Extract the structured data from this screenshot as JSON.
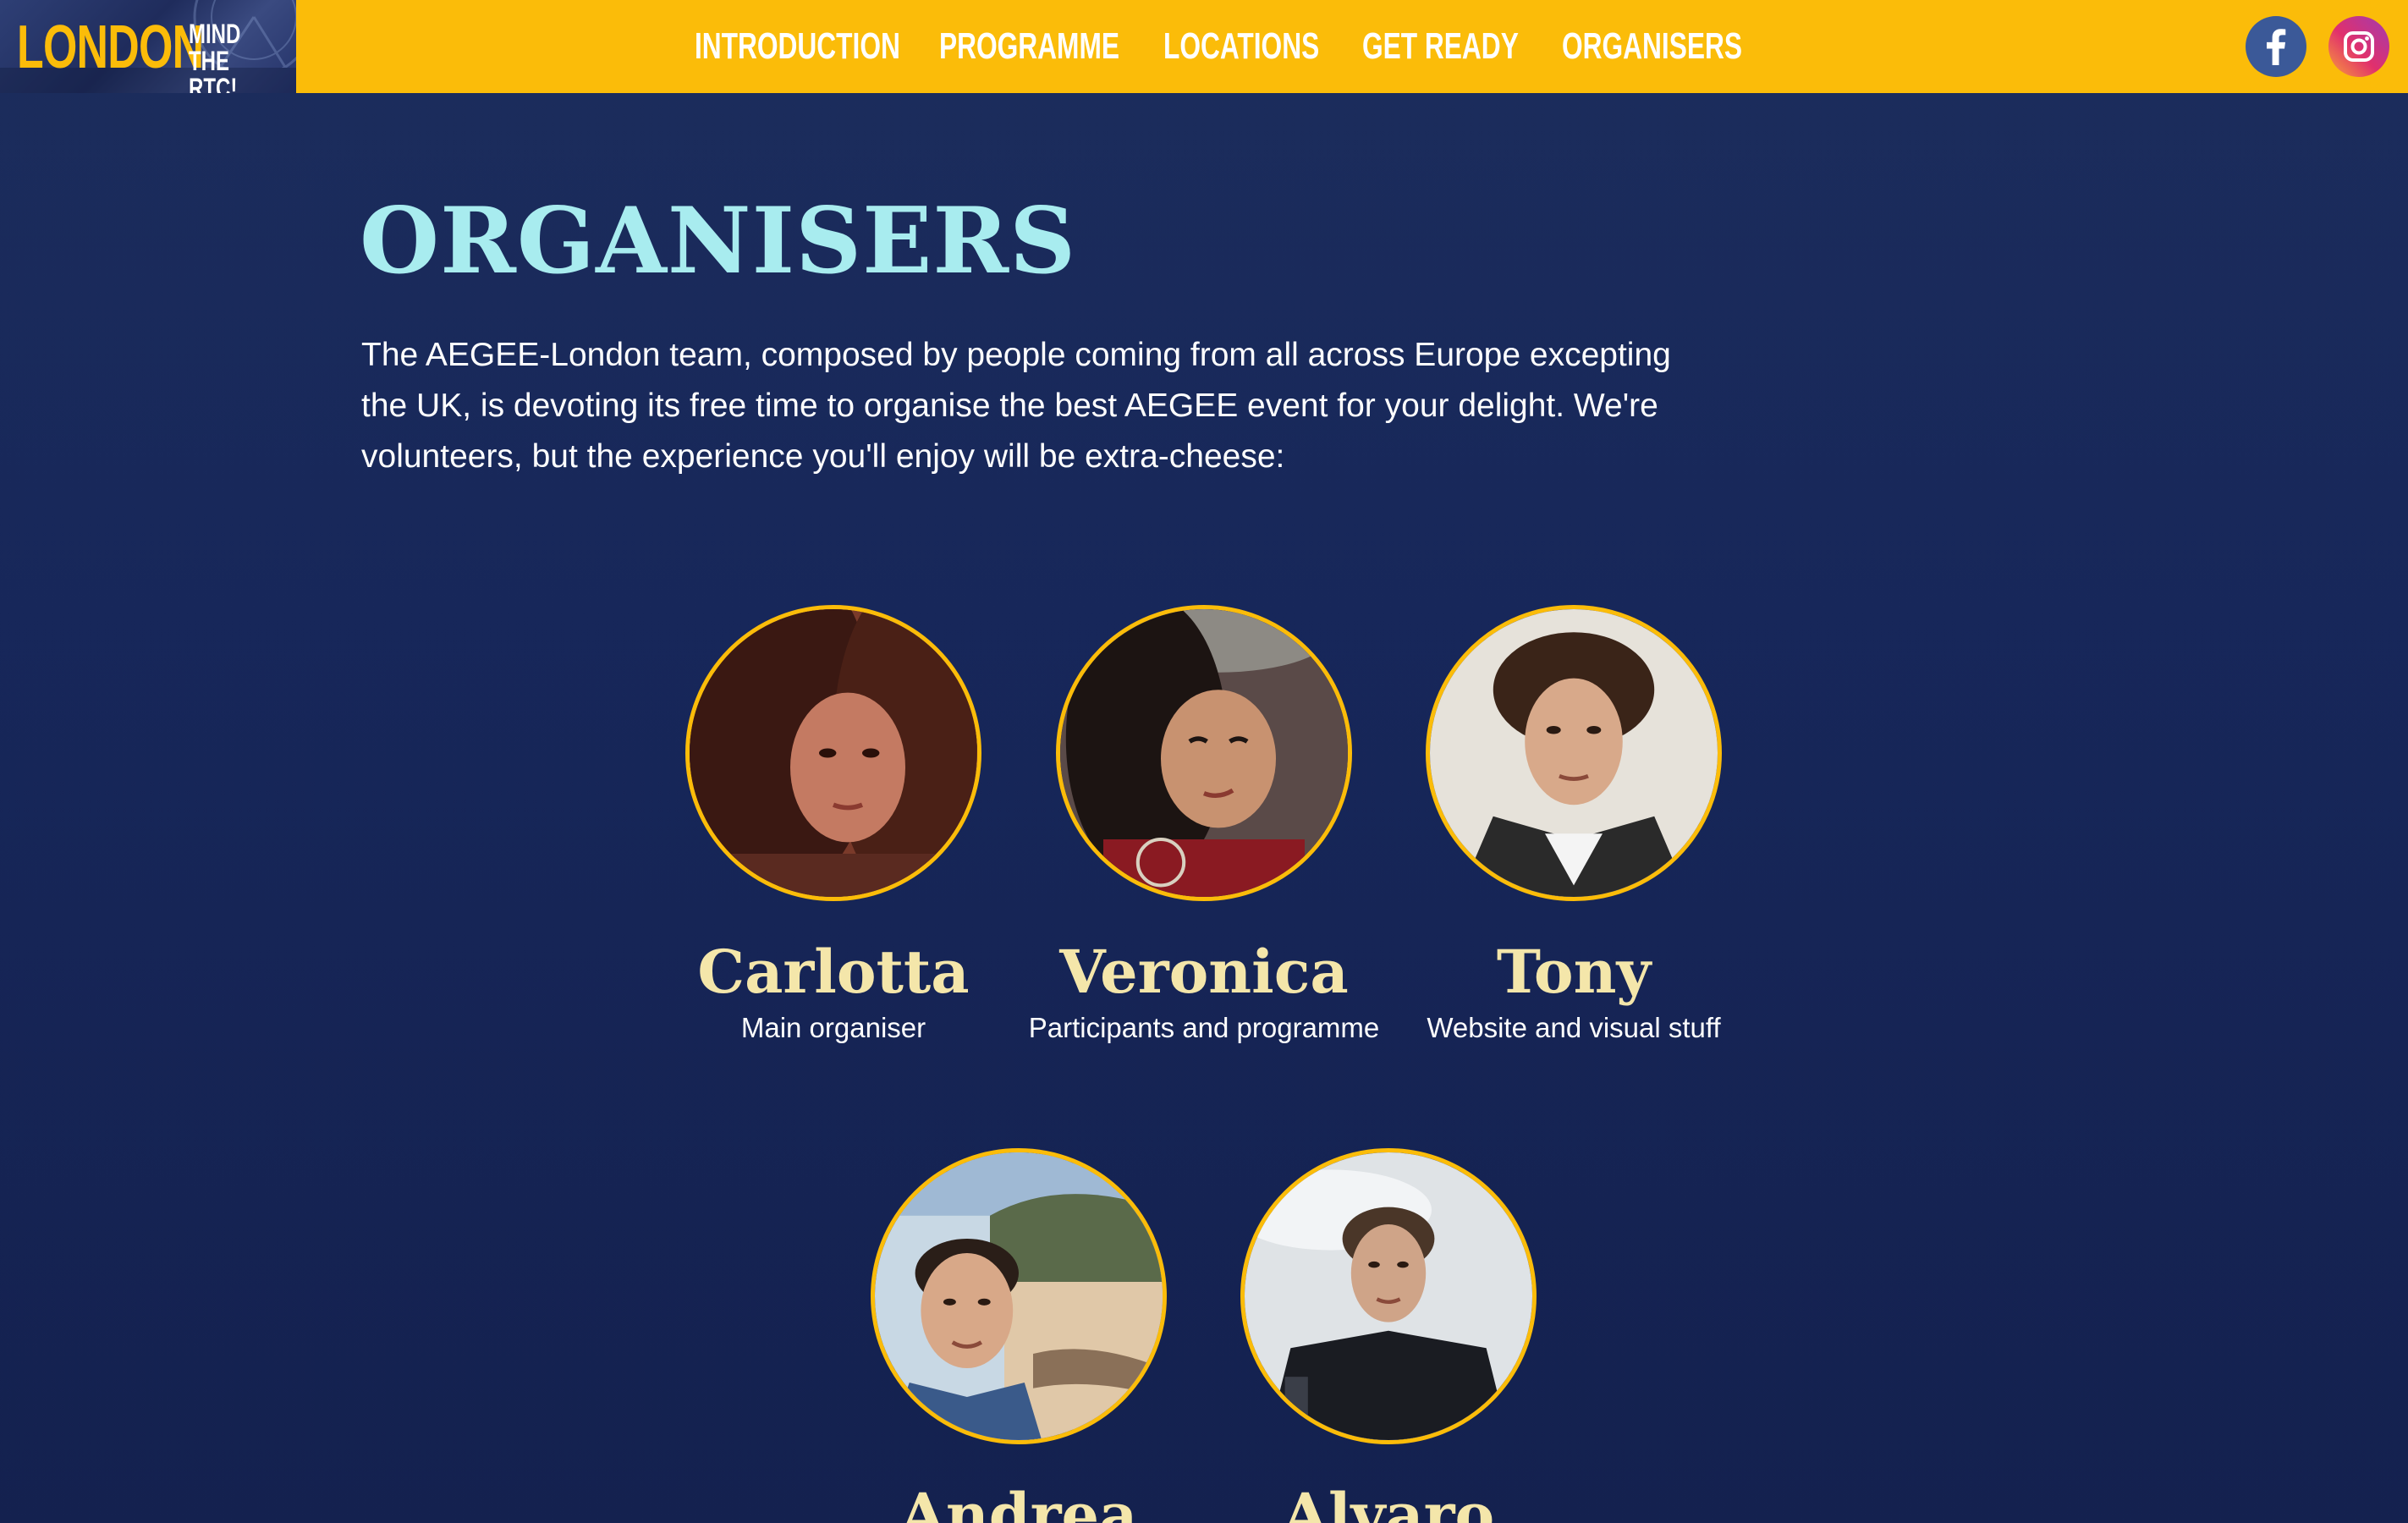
{
  "header": {
    "logo": {
      "main": "LONDON",
      "side_line1": "MIND",
      "side_line2": "THE RTC!"
    },
    "nav": [
      {
        "label": "INTRODUCTION"
      },
      {
        "label": "PROGRAMME"
      },
      {
        "label": "LOCATIONS"
      },
      {
        "label": "GET READY"
      },
      {
        "label": "ORGANISERS"
      }
    ],
    "social": [
      {
        "icon": "facebook-icon",
        "color": "#3b5998"
      },
      {
        "icon": "instagram-icon",
        "color": "#e1306c"
      }
    ]
  },
  "main": {
    "title": "ORGANISERS",
    "intro": "The AEGEE-London team, composed by people coming from all across Europe excepting the UK, is devoting its free time to organise the best AEGEE event for your delight. We're volunteers, but the experience you'll enjoy will be extra-cheese:",
    "organisers": [
      {
        "name": "Carlotta",
        "role": "Main organiser"
      },
      {
        "name": "Veronica",
        "role": "Participants and programme"
      },
      {
        "name": "Tony",
        "role": "Website and visual stuff"
      },
      {
        "name": "Andrea",
        "role": ""
      },
      {
        "name": "Alvaro",
        "role": ""
      }
    ]
  },
  "colors": {
    "accent": "#fbbc09",
    "background": "#17275a",
    "title": "#a8ecef",
    "name": "#f4e6aa"
  }
}
